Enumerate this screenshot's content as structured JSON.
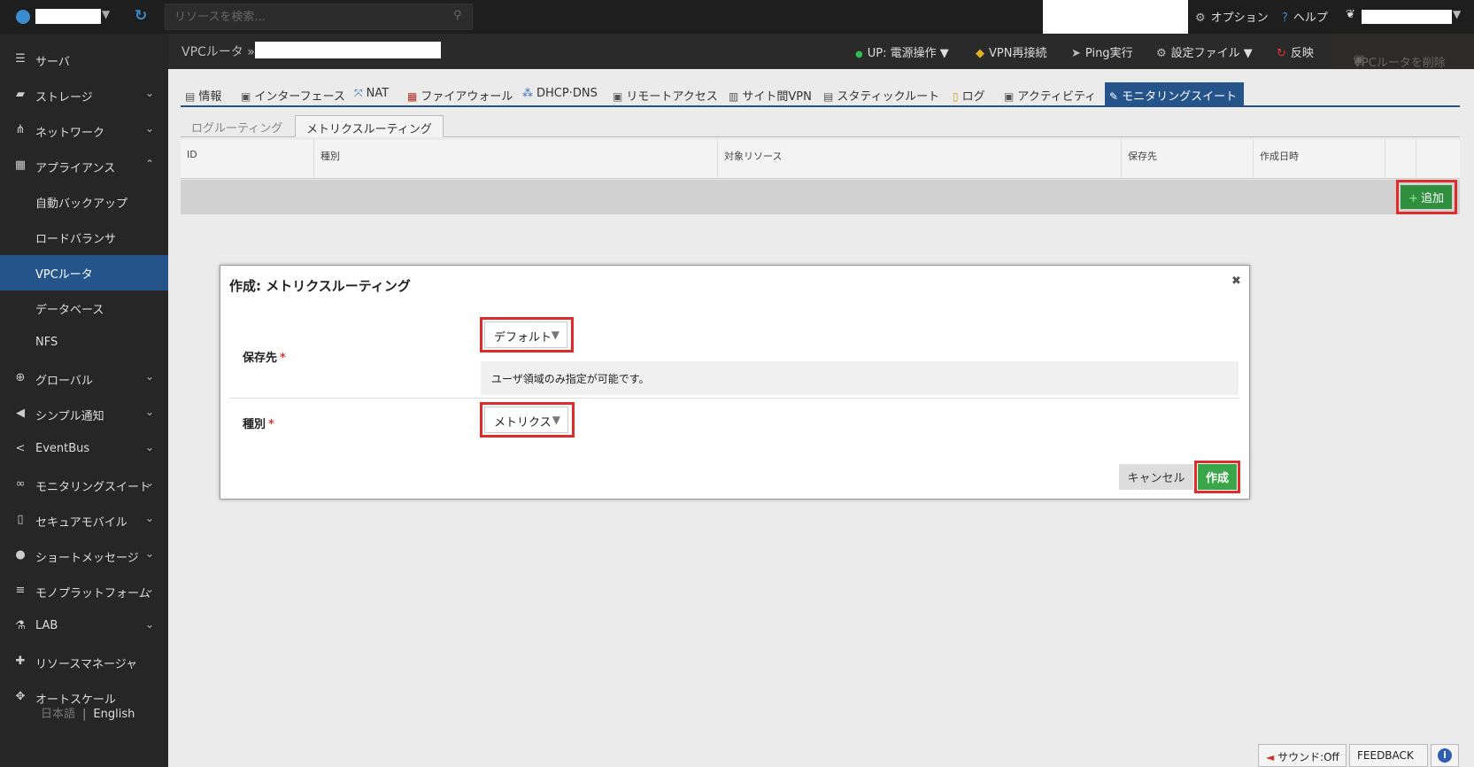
{
  "topbar": {
    "search_placeholder": "リソースを検索...",
    "option": "オプション",
    "help": "ヘルプ"
  },
  "sidebar": {
    "items": [
      {
        "label": "サーバ",
        "icon": "server-icon"
      },
      {
        "label": "ストレージ",
        "icon": "storage-icon"
      },
      {
        "label": "ネットワーク",
        "icon": "network-icon"
      },
      {
        "label": "アプライアンス",
        "icon": "appliance-icon"
      },
      {
        "label": "自動バックアップ"
      },
      {
        "label": "ロードバランサ"
      },
      {
        "label": "VPCルータ"
      },
      {
        "label": "データベース"
      },
      {
        "label": "NFS"
      },
      {
        "label": "グローバル",
        "icon": "globe-icon"
      },
      {
        "label": "シンプル通知",
        "icon": "megaphone-icon"
      },
      {
        "label": "EventBus",
        "icon": "share-icon"
      },
      {
        "label": "モニタリングスイート",
        "icon": "binoculars-icon"
      },
      {
        "label": "セキュアモバイル",
        "icon": "mobile-icon"
      },
      {
        "label": "ショートメッセージ",
        "icon": "chat-icon"
      },
      {
        "label": "モノプラットフォーム",
        "icon": "list-icon"
      },
      {
        "label": "LAB",
        "icon": "flask-icon"
      },
      {
        "label": "リソースマネージャ",
        "icon": "puzzle-icon"
      },
      {
        "label": "オートスケール",
        "icon": "arrows-icon"
      }
    ],
    "lang_ja": "日本語",
    "lang_sep": "|",
    "lang_en": "English"
  },
  "header": {
    "breadcrumb": "VPCルータ »",
    "power": "UP: 電源操作 ▼",
    "vpn": "VPN再接続",
    "ping": "Ping実行",
    "config": "設定ファイル ▼",
    "apply": "反映",
    "delete": "VPCルータを削除"
  },
  "tabs": [
    "情報",
    "インターフェース",
    "NAT",
    "ファイアウォール",
    "DHCP·DNS",
    "リモートアクセス",
    "サイト間VPN",
    "スタティックルート",
    "ログ",
    "アクティビティ",
    "モニタリングスイート"
  ],
  "subtabs": [
    "ログルーティング",
    "メトリクスルーティング"
  ],
  "table": {
    "headers": [
      "ID",
      "種別",
      "対象リソース",
      "保存先",
      "作成日時"
    ]
  },
  "add_button": "追加",
  "modal": {
    "title": "作成: メトリクスルーティング",
    "dest_label": "保存先",
    "dest_value": "デフォルト",
    "hint": "ユーザ領域のみ指定が可能です。",
    "type_label": "種別",
    "type_value": "メトリクス",
    "cancel": "キャンセル",
    "create": "作成"
  },
  "footer": {
    "sound": "サウンド:Off",
    "feedback": "FEEDBACK",
    "info": "i"
  }
}
